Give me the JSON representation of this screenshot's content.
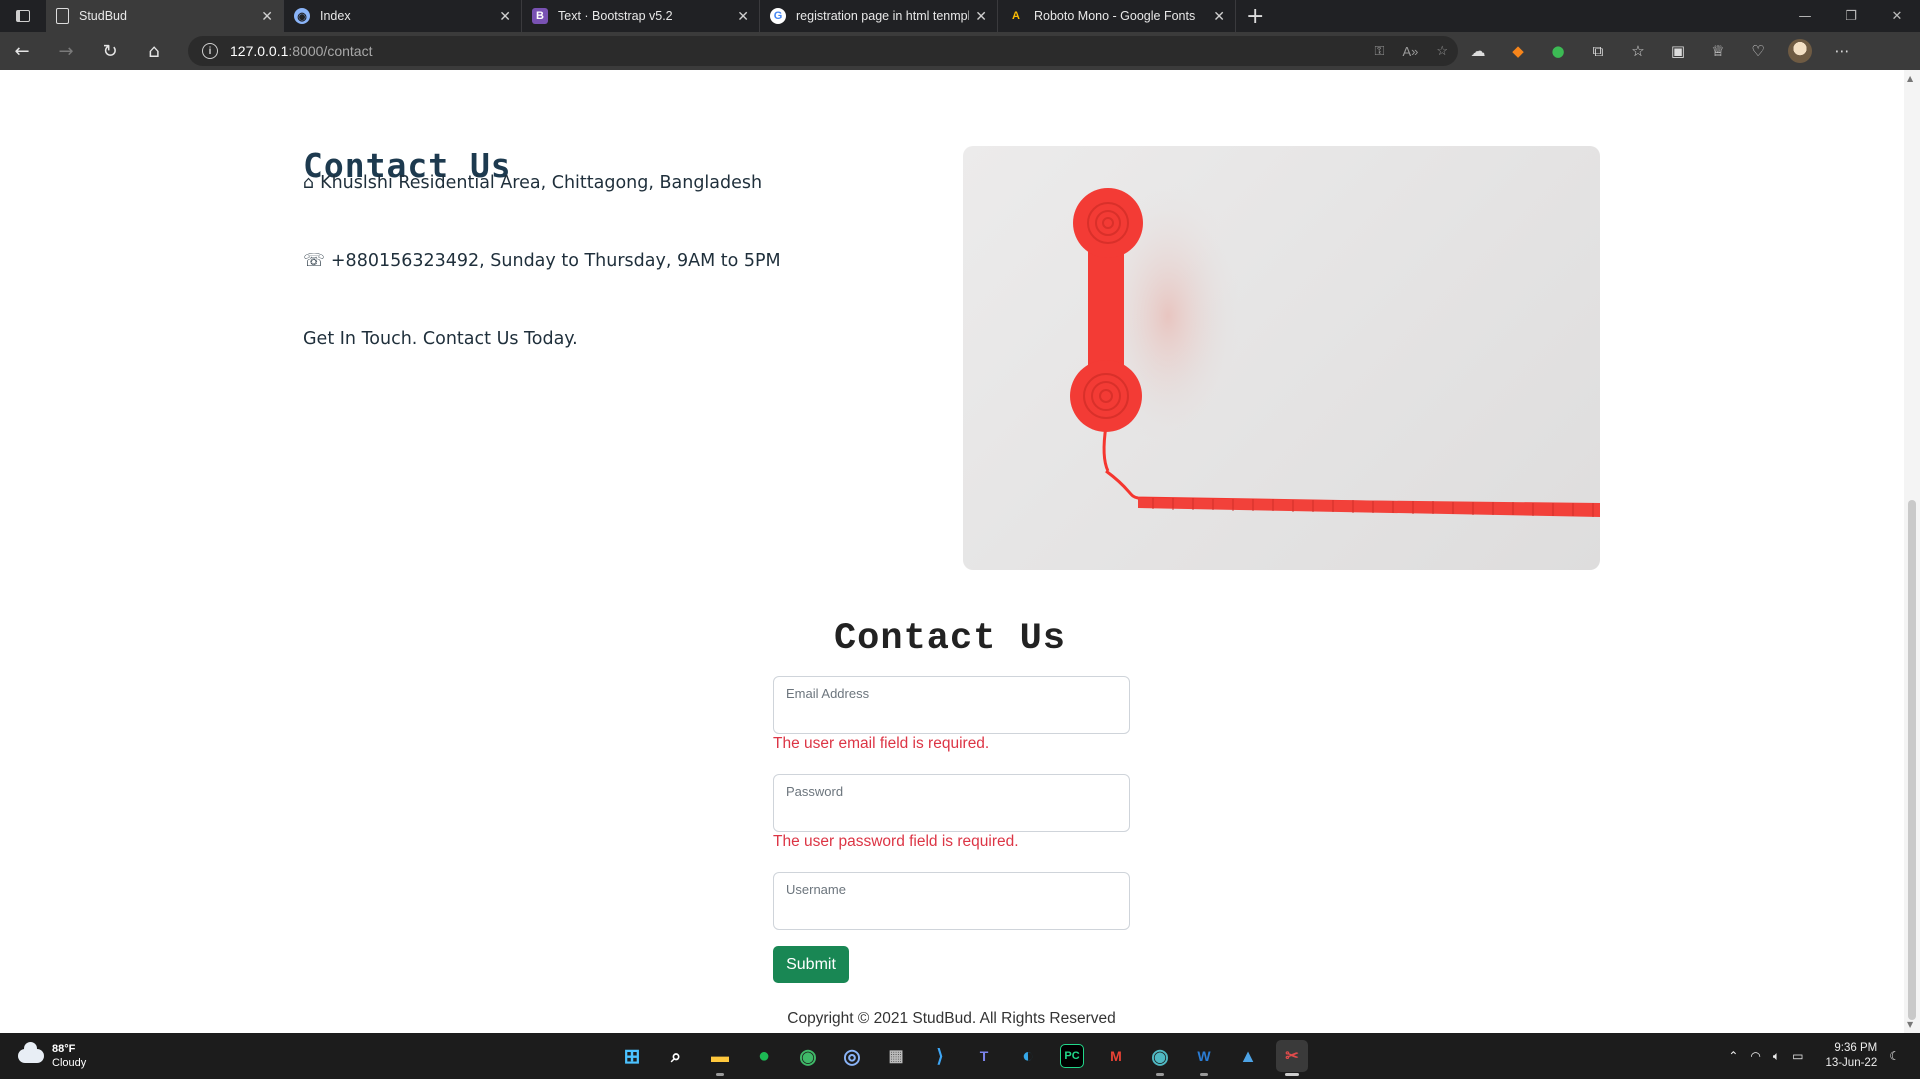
{
  "browser": {
    "tabs": [
      {
        "label": "StudBud",
        "icon": "page-icon",
        "active": true
      },
      {
        "label": "Index",
        "icon": "globe-icon",
        "active": false
      },
      {
        "label": "Text · Bootstrap v5.2",
        "icon": "bootstrap-icon",
        "active": false
      },
      {
        "label": "registration page in html tenmpl",
        "icon": "google-icon",
        "active": false
      },
      {
        "label": "Roboto Mono - Google Fonts",
        "icon": "google-fonts-icon",
        "active": false
      }
    ],
    "url_host": "127.0.0.1",
    "url_path": ":8000/contact"
  },
  "contact_info": {
    "title": "Contact Us",
    "address_icon": "⌂",
    "address": "Khuslshi Residential Area, Chittagong, Bangladesh",
    "phone_icon": "☏",
    "phone": "+880156323492, Sunday to Thursday, 9AM to 5PM",
    "tagline": "Get In Touch. Contact Us Today."
  },
  "form": {
    "title": "Contact Us",
    "email_label": "Email Address",
    "email_error": "The user email field is required.",
    "password_label": "Password",
    "password_error": "The user password field is required.",
    "username_label": "Username",
    "submit_label": "Submit"
  },
  "footer": {
    "copyright": "Copyright © 2021 StudBud. All Rights Reserved"
  },
  "taskbar": {
    "temperature": "88°F",
    "condition": "Cloudy",
    "time": "9:36 PM",
    "date": "13-Jun-22"
  },
  "colors": {
    "error": "#dc3545",
    "submit": "#198754",
    "heading": "#1d3a4f",
    "phone_red": "#f03a3a"
  }
}
